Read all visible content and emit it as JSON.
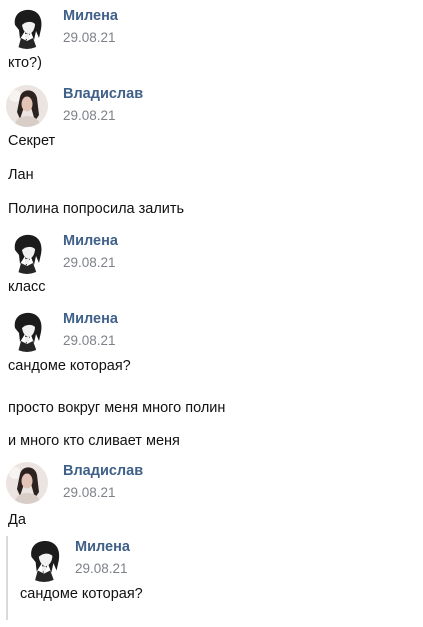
{
  "messages": [
    {
      "name": "Милена",
      "date": "29.08.21",
      "lines": [
        "кто?)"
      ]
    },
    {
      "name": "Владислав",
      "date": "29.08.21",
      "lines": [
        "Секрет",
        "Лан",
        "Полина попросила залить"
      ]
    },
    {
      "name": "Милена",
      "date": "29.08.21",
      "lines": [
        "класс"
      ]
    },
    {
      "name": "Милена",
      "date": "29.08.21",
      "lines": [
        "сандоме которая?",
        "просто вокруг меня много полин",
        "и много кто сливает меня"
      ]
    },
    {
      "name": "Владислав",
      "date": "29.08.21",
      "lines": [
        "Да"
      ]
    }
  ],
  "quoted": {
    "name": "Милена",
    "date": "29.08.21",
    "text": "сандоме которая?"
  },
  "colors": {
    "author": "#3f6088",
    "date": "#7d8288",
    "quote_border": "#d7dbe0"
  }
}
